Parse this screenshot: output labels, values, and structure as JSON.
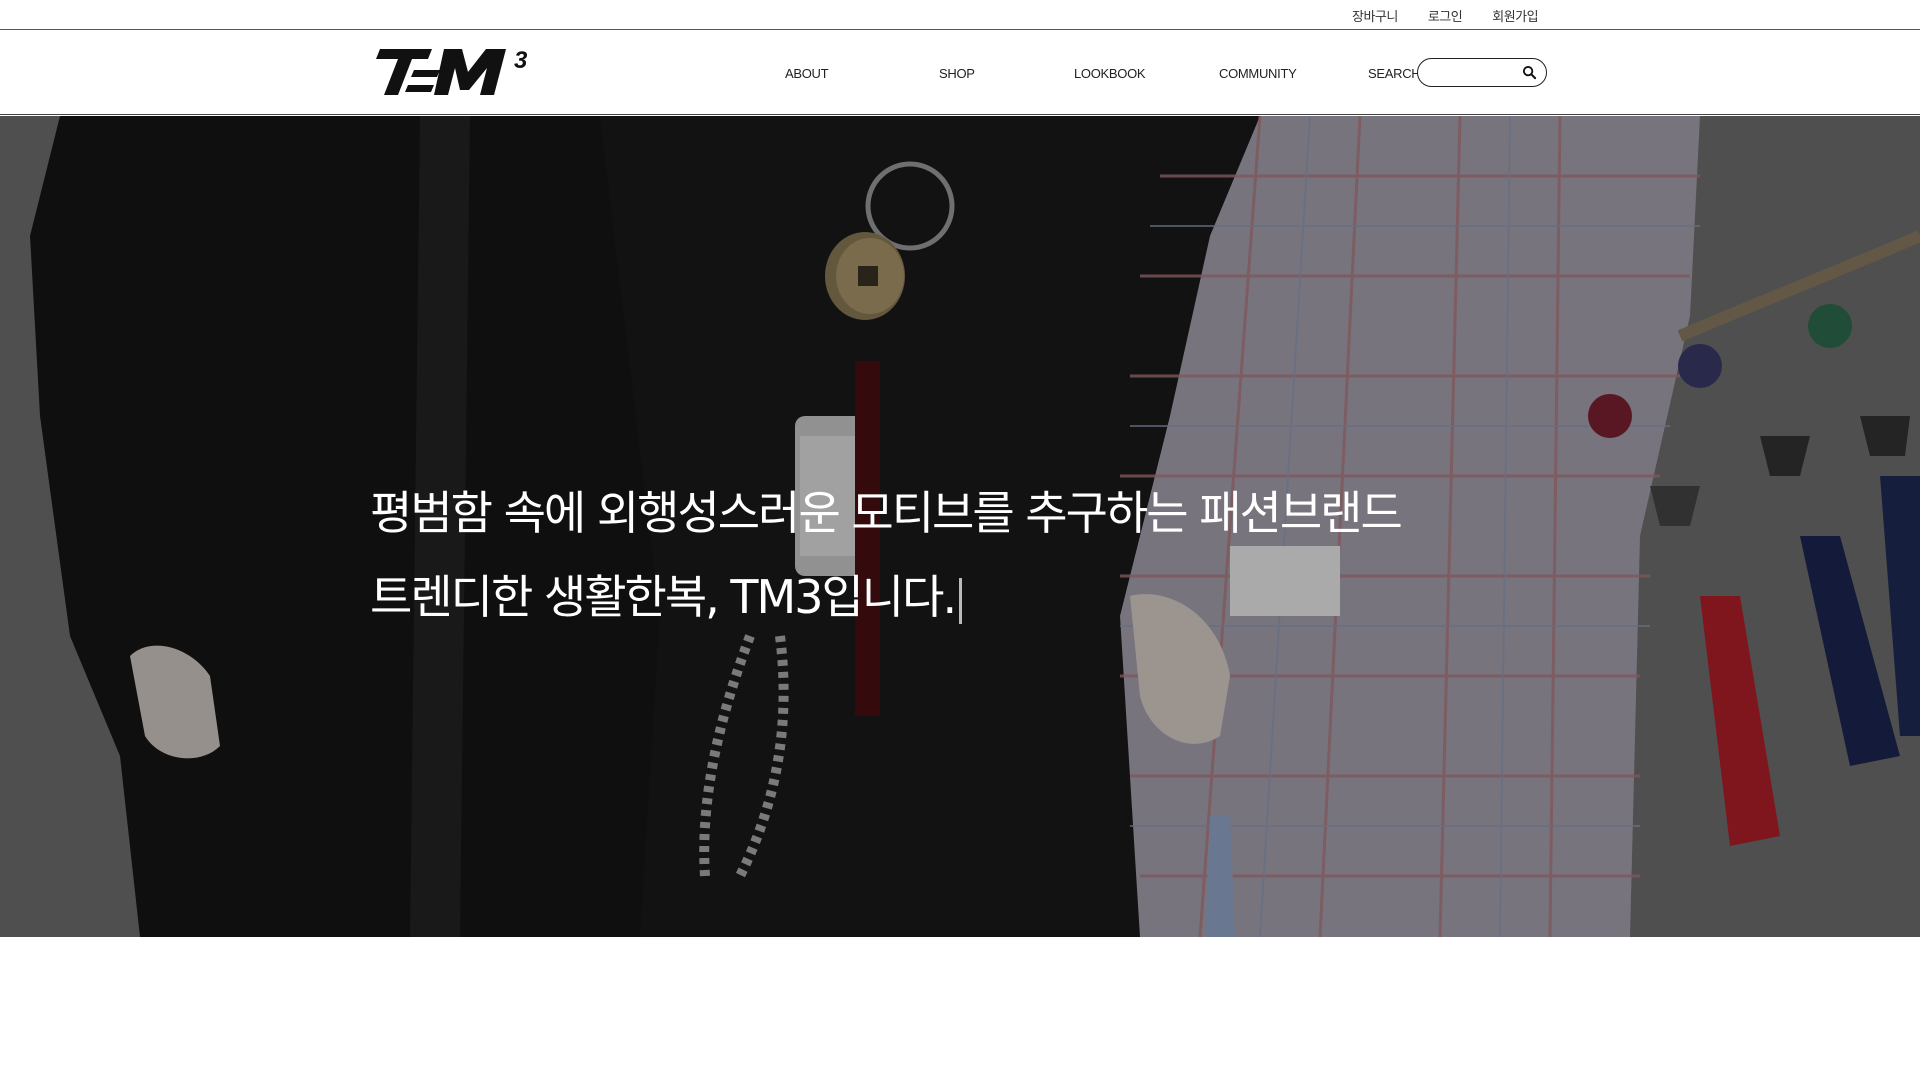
{
  "util_links": {
    "cart": "장바구니",
    "login": "로그인",
    "join": "회원가입"
  },
  "nav": {
    "about": "ABOUT",
    "shop": "SHOP",
    "lookbook": "LOOKBOOK",
    "community": "COMMUNITY"
  },
  "search": {
    "label": "SEARCH",
    "value": "",
    "icon": "search-icon"
  },
  "logo": {
    "text": "T=M",
    "superscript": "3"
  },
  "hero": {
    "line1": "평범함 속에 외행성스러운 모티브를 추구하는 패션브랜드",
    "line2": "트렌디한 생활한복, TM3입니다."
  },
  "colors": {
    "hero_overlay": "#6d6d6d",
    "text": "#ffffff",
    "accent": "#222222"
  }
}
